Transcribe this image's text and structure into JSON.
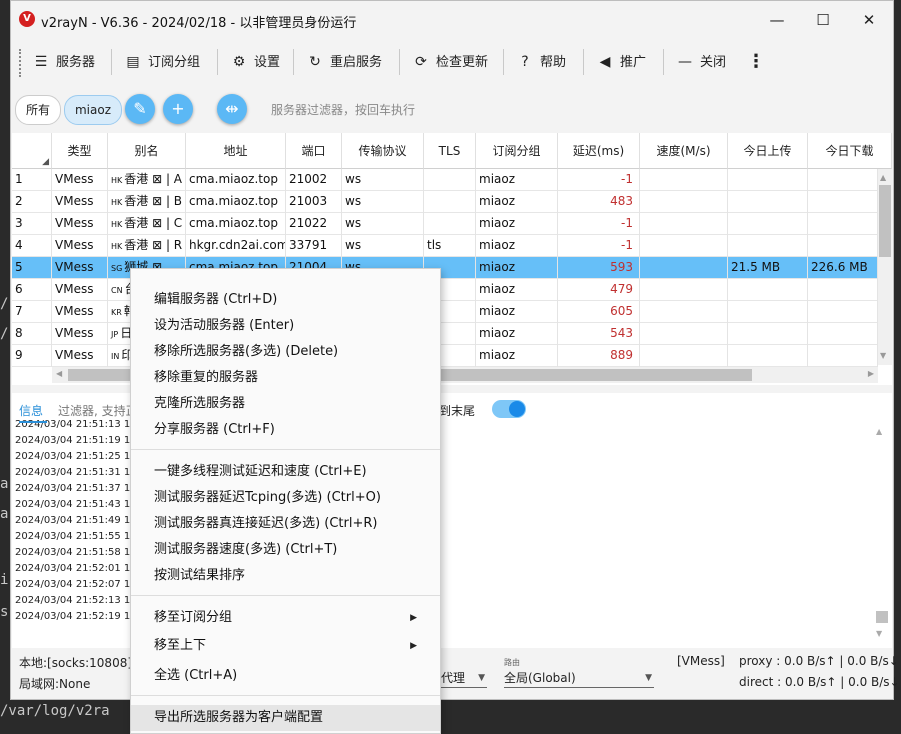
{
  "window": {
    "title": "v2rayN - V6.36 - 2024/02/18 - 以非管理员身份运行",
    "logo_letter": "V",
    "minimize_icon": "—",
    "maximize_icon": "☐",
    "close_icon": "✕"
  },
  "toolbar": {
    "servers": "服务器",
    "subscription": "订阅分组",
    "settings": "设置",
    "restart": "重启服务",
    "check_update": "检查更新",
    "help": "帮助",
    "promote": "推广",
    "close": "关闭",
    "more": "⋮"
  },
  "filter": {
    "chip_all": "所有",
    "chip_group": "miaoz",
    "search_placeholder": "服务器过滤器，按回车执行"
  },
  "table": {
    "headers": [
      "类型",
      "别名",
      "地址",
      "端口",
      "传输协议",
      "TLS",
      "订阅分组",
      "延迟(ms)",
      "速度(M/s)",
      "今日上传",
      "今日下载"
    ],
    "rows": [
      {
        "num": "1",
        "type": "VMess",
        "flag": "HK",
        "alias": "香港 ⊠ | A",
        "address": "cma.miaoz.top",
        "port": "21002",
        "transport": "ws",
        "tls": "",
        "group": "miaoz",
        "delay": "-1",
        "speed": "",
        "up": "",
        "down": ""
      },
      {
        "num": "2",
        "type": "VMess",
        "flag": "HK",
        "alias": "香港 ⊠ | B",
        "address": "cma.miaoz.top",
        "port": "21003",
        "transport": "ws",
        "tls": "",
        "group": "miaoz",
        "delay": "483",
        "speed": "",
        "up": "",
        "down": ""
      },
      {
        "num": "3",
        "type": "VMess",
        "flag": "HK",
        "alias": "香港 ⊠ | C",
        "address": "cma.miaoz.top",
        "port": "21022",
        "transport": "ws",
        "tls": "",
        "group": "miaoz",
        "delay": "-1",
        "speed": "",
        "up": "",
        "down": ""
      },
      {
        "num": "4",
        "type": "VMess",
        "flag": "HK",
        "alias": "香港 ⊠ | R",
        "address": "hkgr.cdn2ai.com",
        "port": "33791",
        "transport": "ws",
        "tls": "tls",
        "group": "miaoz",
        "delay": "-1",
        "speed": "",
        "up": "",
        "down": ""
      },
      {
        "num": "5",
        "type": "VMess",
        "flag": "SG",
        "alias": "狮城 ⊠",
        "address": "cma.miaoz.top",
        "port": "21004",
        "transport": "ws",
        "tls": "",
        "group": "miaoz",
        "delay": "593",
        "speed": "",
        "up": "21.5 MB",
        "down": "226.6 MB"
      },
      {
        "num": "6",
        "type": "VMess",
        "flag": "CN",
        "alias": "台",
        "address": "",
        "port": "",
        "transport": "",
        "tls": "",
        "group": "miaoz",
        "delay": "479",
        "speed": "",
        "up": "",
        "down": ""
      },
      {
        "num": "7",
        "type": "VMess",
        "flag": "KR",
        "alias": "韩",
        "address": "",
        "port": "",
        "transport": "",
        "tls": "",
        "group": "miaoz",
        "delay": "605",
        "speed": "",
        "up": "",
        "down": ""
      },
      {
        "num": "8",
        "type": "VMess",
        "flag": "JP",
        "alias": "日",
        "address": "",
        "port": "",
        "transport": "",
        "tls": "",
        "group": "miaoz",
        "delay": "543",
        "speed": "",
        "up": "",
        "down": ""
      },
      {
        "num": "9",
        "type": "VMess",
        "flag": "IN",
        "alias": "印",
        "address": "",
        "port": "",
        "transport": "",
        "tls": "",
        "group": "miaoz",
        "delay": "889",
        "speed": "",
        "up": "",
        "down": ""
      }
    ]
  },
  "log": {
    "tab_label": "信息",
    "filter_placeholder": "过滤器, 支持正",
    "autoscroll_label": "到末尾",
    "lines": [
      "2024/03/04 21:51:13 12",
      "2024/03/04 21:51:19 12",
      "2024/03/04 21:51:25 12",
      "2024/03/04 21:51:31 12",
      "2024/03/04 21:51:37 12",
      "2024/03/04 21:51:43 12",
      "2024/03/04 21:51:49 12",
      "2024/03/04 21:51:55 12",
      "2024/03/04 21:51:58 12",
      "2024/03/04 21:52:01 12",
      "2024/03/04 21:52:07 12",
      "2024/03/04 21:52:13 12",
      "2024/03/04 21:52:19 12"
    ]
  },
  "status": {
    "local": "本地:[socks:10808] |",
    "lan": "局域网:None",
    "proxy_mode": "代理",
    "routing_label": "路由",
    "routing_value": "全局(Global)",
    "protocol": "[VMess]",
    "proxy_speed": "proxy : 0.0 B/s↑ | 0.0 B/s↓",
    "direct_speed": "direct : 0.0 B/s↑ | 0.0 B/s↓"
  },
  "context_menu": {
    "items": [
      "编辑服务器 (Ctrl+D)",
      "设为活动服务器 (Enter)",
      "移除所选服务器(多选) (Delete)",
      "移除重复的服务器",
      "克隆所选服务器",
      "分享服务器 (Ctrl+F)",
      "一键多线程测试延迟和速度 (Ctrl+E)",
      "测试服务器延迟Tcping(多选) (Ctrl+O)",
      "测试服务器真连接延迟(多选) (Ctrl+R)",
      "测试服务器速度(多选) (Ctrl+T)",
      "按测试结果排序",
      "移至订阅分组",
      "移至上下",
      "全选 (Ctrl+A)",
      "导出所选服务器为客户端配置"
    ]
  },
  "background": {
    "lines": [
      "/",
      "/",
      "a",
      "a",
      "i",
      "s",
      "/var/log/v2ra"
    ]
  },
  "colors": {
    "accent": "#5bb8f5",
    "selection": "#66bff8",
    "delay_text": "#c03030"
  }
}
